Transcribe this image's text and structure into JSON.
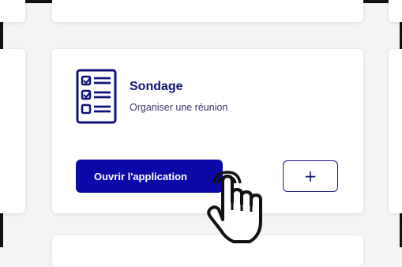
{
  "card": {
    "icon": "poll-checklist-icon",
    "title": "Sondage",
    "subtitle": "Organiser une réunion",
    "open_button_label": "Ouvrir l'application",
    "add_button_label": "+",
    "add_icon": "plus-icon"
  },
  "cursor": {
    "icon": "hand-pointer-cursor-icon"
  },
  "colors": {
    "accent": "#0b0aa8",
    "title": "#101478",
    "background": "#f4f4f7"
  }
}
